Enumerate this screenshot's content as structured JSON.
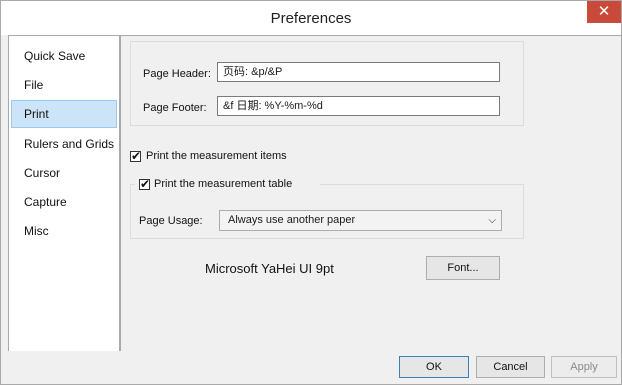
{
  "window": {
    "title": "Preferences",
    "close_glyph": "✕"
  },
  "sidebar": {
    "items": [
      {
        "label": "Quick Save"
      },
      {
        "label": "File"
      },
      {
        "label": "Print",
        "selected": true
      },
      {
        "label": "Rulers and Grids"
      },
      {
        "label": "Cursor"
      },
      {
        "label": "Capture"
      },
      {
        "label": "Misc"
      }
    ]
  },
  "print": {
    "header_label": "Page Header:",
    "header_value": "页码: &p/&P",
    "footer_label": "Page Footer:",
    "footer_value": "&f 日期: %Y-%m-%d",
    "measurement_items_label": "Print the measurement items",
    "measurement_items_checked": true,
    "measurement_table_label": "Print the measurement table",
    "measurement_table_checked": true,
    "page_usage_label": "Page Usage:",
    "page_usage_value": "Always use another paper",
    "font_name": "Microsoft YaHei UI 9pt",
    "font_button": "Font..."
  },
  "buttons": {
    "ok": "OK",
    "cancel": "Cancel",
    "apply": "Apply"
  },
  "icons": {
    "check": "✔",
    "dropdown": "⌵"
  }
}
